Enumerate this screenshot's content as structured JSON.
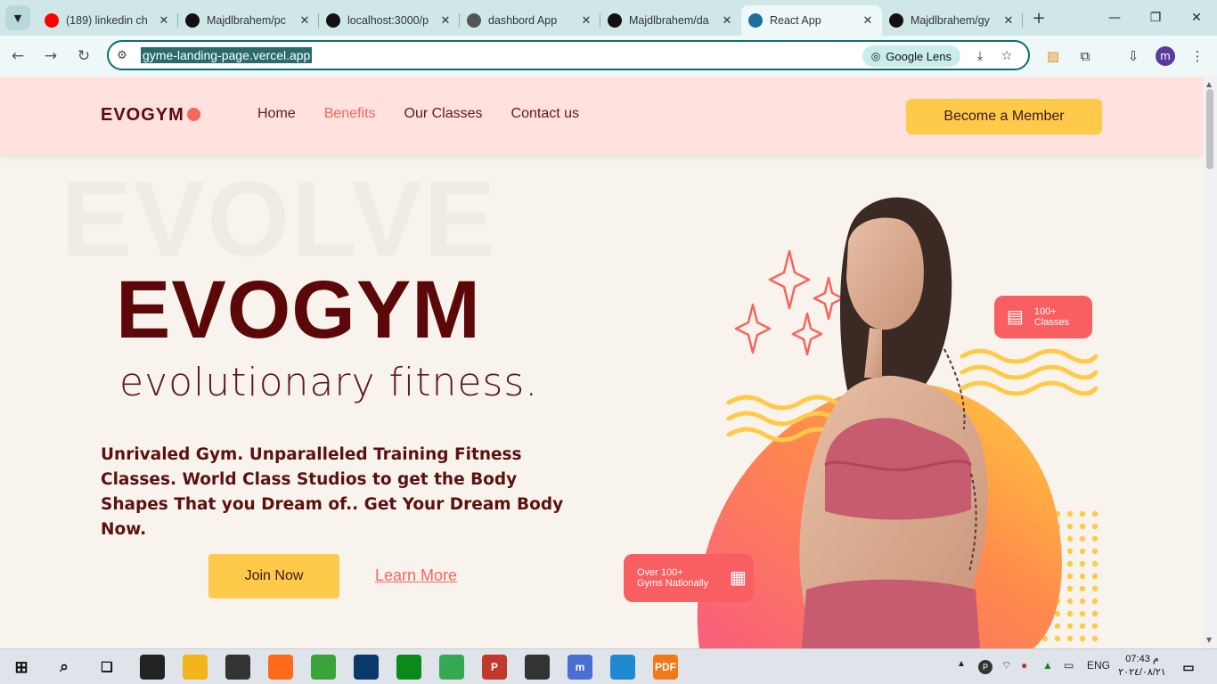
{
  "browser": {
    "tabs": [
      {
        "title": "(189) linkedin ch",
        "icon": "youtube-icon",
        "color": "#ff0000"
      },
      {
        "title": "Majdlbrahem/pc",
        "icon": "github-icon",
        "color": "#111111"
      },
      {
        "title": "localhost:3000/p",
        "icon": "triangle-icon",
        "color": "#111111"
      },
      {
        "title": "dashbord App",
        "icon": "globe-icon",
        "color": "#555555"
      },
      {
        "title": "Majdlbrahem/da",
        "icon": "github-icon",
        "color": "#111111"
      },
      {
        "title": "React App",
        "icon": "react-icon",
        "color": "#1e6e9e",
        "active": true
      },
      {
        "title": "Majdlbrahem/gy",
        "icon": "github-icon",
        "color": "#111111"
      }
    ],
    "url": "gyme-landing-page.vercel.app",
    "google_lens": "Google Lens",
    "profile_initial": "m"
  },
  "site": {
    "logo": "EVOGYM",
    "nav": [
      {
        "label": "Home"
      },
      {
        "label": "Benefits",
        "active": true
      },
      {
        "label": "Our Classes"
      },
      {
        "label": "Contact us"
      }
    ],
    "member_button": "Become a Member",
    "bg_word": "EVOLVE",
    "hero_title": "EVOGYM",
    "hero_subtitle": "evolutionary fitness.",
    "hero_text": "Unrivaled Gym. Unparalleled Training Fitness Classes. World Class Studios to get the Body Shapes That you Dream of.. Get Your Dream Body Now.",
    "join_button": "Join Now",
    "learn_link": "Learn More",
    "badge_classes_line1": "100+",
    "badge_classes_line2": "Classes",
    "badge_gyms_line1": "Over 100+",
    "badge_gyms_line2": "Gyms Nationally",
    "colors": {
      "primary": "#5c0808",
      "accent": "#f5665f",
      "button": "#ffc94a",
      "nav_bg": "#ffe1dd",
      "page_bg": "#f8f4ed"
    }
  },
  "taskbar": {
    "apps": [
      {
        "name": "camera-app-icon",
        "label": "",
        "color": "#222222"
      },
      {
        "name": "file-explorer-icon",
        "label": "",
        "color": "#f2b51c"
      },
      {
        "name": "headphones-app-icon",
        "label": "",
        "color": "#333333"
      },
      {
        "name": "firefox-icon",
        "label": "",
        "color": "#ff6a1a"
      },
      {
        "name": "paint-app-icon",
        "label": "",
        "color": "#3aa33a"
      },
      {
        "name": "dolby-app-icon",
        "label": "",
        "color": "#0a3a6a"
      },
      {
        "name": "delta-app-icon",
        "label": "",
        "color": "#0b8a1a"
      },
      {
        "name": "chrome-icon",
        "label": "",
        "color": "#34a853"
      },
      {
        "name": "psiphon-icon",
        "label": "P",
        "color": "#c0392b"
      },
      {
        "name": "settings-icon",
        "label": "",
        "color": "#333333"
      },
      {
        "name": "chrome-profile-icon",
        "label": "m",
        "color": "#4a6fd1"
      },
      {
        "name": "vscode-icon",
        "label": "",
        "color": "#1f8ad2"
      },
      {
        "name": "pdf-app-icon",
        "label": "PDF",
        "color": "#f07a1a"
      }
    ],
    "lang": "ENG",
    "time": "07:43 م",
    "date": "٢٠٢٤/٠٨/٢١"
  }
}
